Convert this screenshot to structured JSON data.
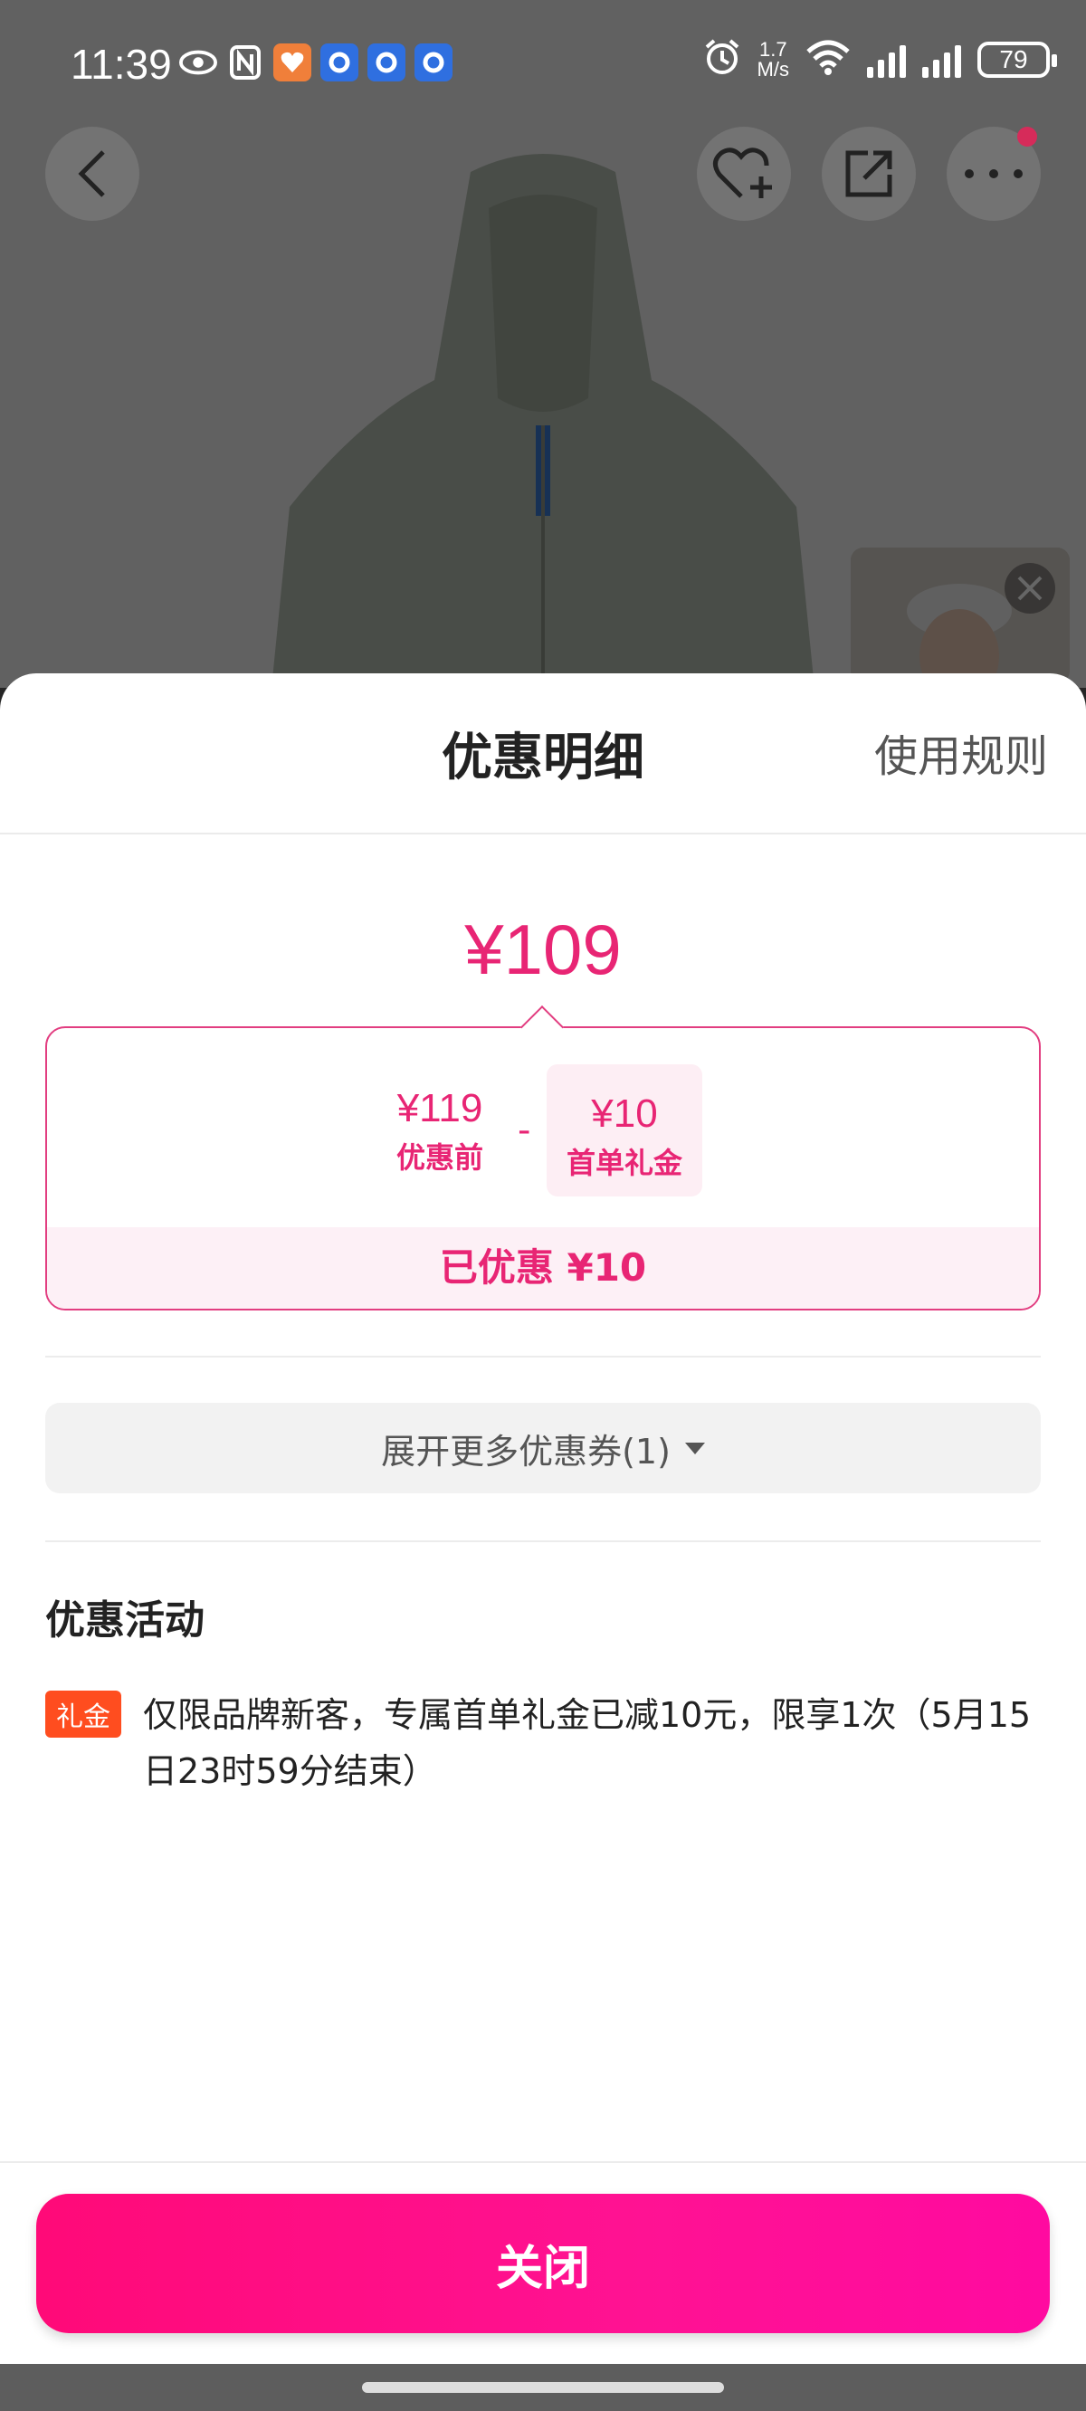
{
  "status_bar": {
    "time": "11:39",
    "network_speed": "1.7",
    "network_speed_unit": "M/s",
    "battery": "79",
    "left_icons": [
      "eye-icon",
      "nfc-icon",
      "health-app-icon",
      "search-app-icon",
      "search-app-icon",
      "search-app-icon"
    ],
    "right_icons": [
      "alarm-icon",
      "wifi-icon",
      "signal-icon",
      "signal-icon",
      "battery-icon"
    ]
  },
  "product_page": {
    "top_buttons": [
      "back-icon",
      "favorite-add-icon",
      "share-icon",
      "more-icon"
    ]
  },
  "sheet": {
    "title": "优惠明细",
    "rules_link": "使用规则",
    "final_price": "¥109",
    "calculation": {
      "original_amount": "¥119",
      "original_label": "优惠前",
      "minus": "-",
      "discount_amount": "¥10",
      "discount_label": "首单礼金"
    },
    "saved_text": "已优惠 ¥10",
    "expand_button": "展开更多优惠券(1)",
    "section_title": "优惠活动",
    "promo": {
      "tag": "礼金",
      "text": "仅限品牌新客，专属首单礼金已减10元，限享1次（5月15日23时59分结束）"
    },
    "close_button": "关闭"
  },
  "colors": {
    "accent": "#e82574",
    "button_gradient_start": "#ff0a78",
    "button_gradient_end": "#ff0aa0",
    "tag": "#ff4d1f"
  }
}
